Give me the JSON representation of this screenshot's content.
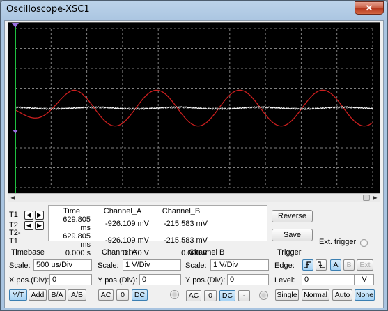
{
  "window": {
    "title": "Oscilloscope-XSC1",
    "close_glyph": "✕"
  },
  "colors": {
    "grid": "#808080",
    "channel_a": "#ffffff",
    "channel_b": "#cc1f1f",
    "cursor": "#1fbf3f",
    "screen": "#000000"
  },
  "scope": {
    "divisions": {
      "x": 10,
      "y": 8
    },
    "channel_a": {
      "amplitude_div": 0.05,
      "periods_on_screen": 4.3,
      "phase": 0.3,
      "offset_div": 0
    },
    "channel_b": {
      "amplitude_div": 0.18,
      "periods_on_screen": 4.3,
      "phase": 0.55,
      "offset_div": 0,
      "envelope_start": 0.35
    },
    "cursor_t1_div": 0,
    "icons": [
      "cursor-t1-marker-icon",
      "ground-marker-icon"
    ]
  },
  "cursors": {
    "t1_label": "T1",
    "t2_label": "T2",
    "t2t1_label": "T2-T1",
    "left_arrow": "◀",
    "right_arrow": "▶"
  },
  "readout": {
    "headers": [
      "Time",
      "Channel_A",
      "Channel_B"
    ],
    "rows": [
      [
        "629.805 ms",
        "-926.109 mV",
        "-215.583 mV"
      ],
      [
        "629.805 ms",
        "-926.109 mV",
        "-215.583 mV"
      ],
      [
        "0.000 s",
        "0.000 V",
        "0.000 V"
      ]
    ]
  },
  "buttons": {
    "reverse": "Reverse",
    "save": "Save"
  },
  "ext_trigger": {
    "label": "Ext. trigger"
  },
  "timebase": {
    "title": "Timebase",
    "scale_label": "Scale:",
    "scale_value": "500 us/Div",
    "xpos_label": "X pos.(Div):",
    "xpos_value": "0",
    "modes": [
      "Y/T",
      "Add",
      "B/A",
      "A/B"
    ],
    "active_mode": "Y/T"
  },
  "channel_a": {
    "title": "Channel A",
    "scale_label": "Scale:",
    "scale_value": "1  V/Div",
    "ypos_label": "Y pos.(Div):",
    "ypos_value": "0",
    "coupling": [
      "AC",
      "0",
      "DC"
    ],
    "active_coupling": "DC"
  },
  "channel_b": {
    "title": "Channel B",
    "scale_label": "Scale:",
    "scale_value": "1  V/Div",
    "ypos_label": "Y pos.(Div):",
    "ypos_value": "0",
    "coupling": [
      "AC",
      "0",
      "DC",
      "-"
    ],
    "active_coupling": "DC"
  },
  "trigger": {
    "title": "Trigger",
    "edge_label": "Edge:",
    "sources": [
      "A",
      "B",
      "Ext"
    ],
    "active_source": "A",
    "level_label": "Level:",
    "level_value": "0",
    "level_unit": "V",
    "modes": [
      "Single",
      "Normal",
      "Auto",
      "None"
    ],
    "active_mode": "None"
  }
}
